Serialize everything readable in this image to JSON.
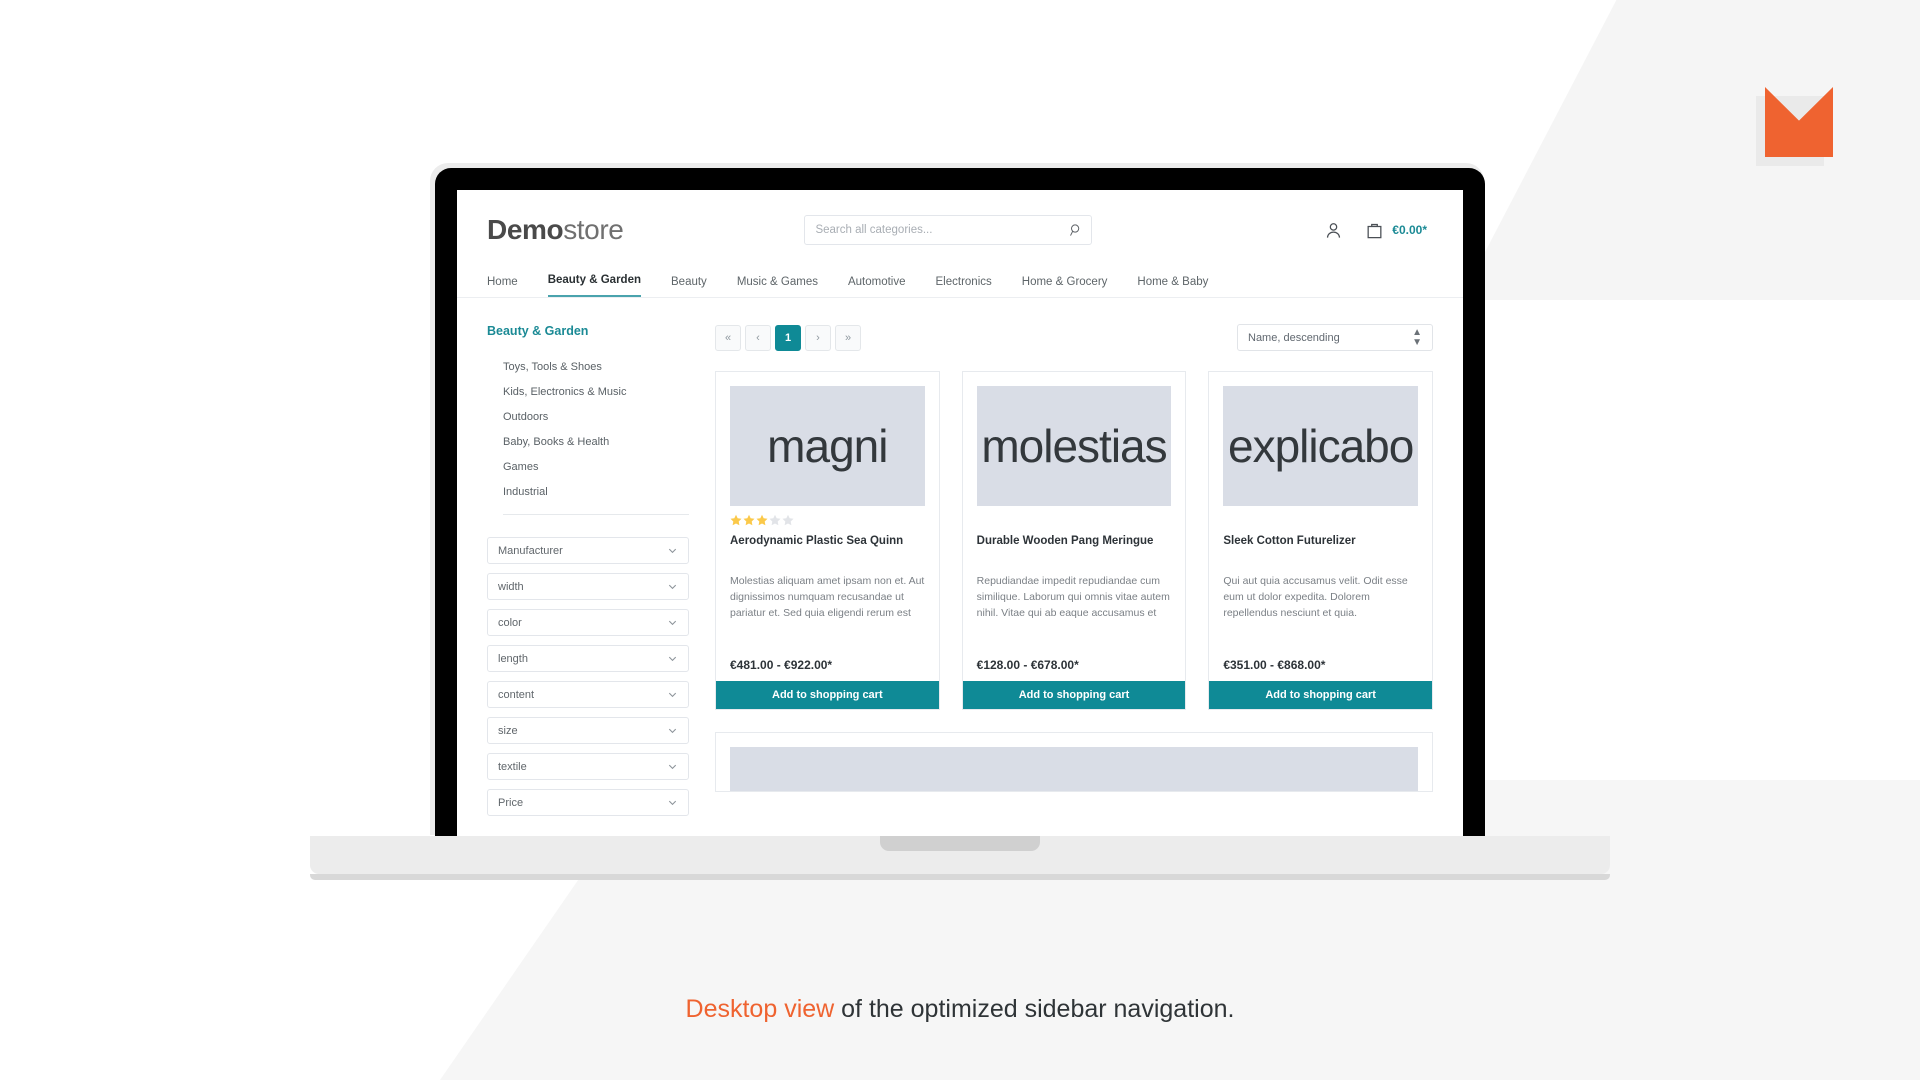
{
  "caption": {
    "highlight": "Desktop view",
    "rest": " of the optimized sidebar navigation."
  },
  "brand": {
    "logo_name": "shopware-m-logo",
    "accent_color": "#ef6330"
  },
  "shop": {
    "logo_bold": "Demo",
    "logo_light": "store",
    "search": {
      "placeholder": "Search all categories...",
      "value": "",
      "icon": "search-icon"
    },
    "account_icon": "user-icon",
    "cart_icon": "bag-icon",
    "cart_amount": "€0.00*",
    "accent_color": "#0f8a96",
    "nav": [
      {
        "label": "Home",
        "active": false
      },
      {
        "label": "Beauty & Garden",
        "active": true
      },
      {
        "label": "Beauty",
        "active": false
      },
      {
        "label": "Music & Games",
        "active": false
      },
      {
        "label": "Automotive",
        "active": false
      },
      {
        "label": "Electronics",
        "active": false
      },
      {
        "label": "Home & Grocery",
        "active": false
      },
      {
        "label": "Home & Baby",
        "active": false
      }
    ]
  },
  "sidebar": {
    "category_title": "Beauty & Garden",
    "categories": [
      {
        "label": "Toys, Tools & Shoes"
      },
      {
        "label": "Kids, Electronics & Music"
      },
      {
        "label": "Outdoors"
      },
      {
        "label": "Baby, Books & Health"
      },
      {
        "label": "Games"
      },
      {
        "label": "Industrial"
      }
    ],
    "filters": [
      {
        "label": "Manufacturer"
      },
      {
        "label": "width"
      },
      {
        "label": "color"
      },
      {
        "label": "length"
      },
      {
        "label": "content"
      },
      {
        "label": "size"
      },
      {
        "label": "textile"
      },
      {
        "label": "Price"
      }
    ]
  },
  "toolbar": {
    "pagination": [
      {
        "label": "«",
        "name": "pagination-first",
        "current": false
      },
      {
        "label": "‹",
        "name": "pagination-prev",
        "current": false
      },
      {
        "label": "1",
        "name": "pagination-page-1",
        "current": true
      },
      {
        "label": "›",
        "name": "pagination-next",
        "current": false
      },
      {
        "label": "»",
        "name": "pagination-last",
        "current": false
      }
    ],
    "sort_value": "Name, descending"
  },
  "products": [
    {
      "image_text": "magni",
      "rating": 3,
      "rating_max": 5,
      "title": "Aerodynamic Plastic Sea Quinn",
      "description": "Molestias aliquam amet ipsam non et. Aut dignissimos numquam recusandae ut pariatur et. Sed quia eligendi rerum est",
      "price": "€481.00 - €922.00*",
      "buy_label": "Add to shopping cart"
    },
    {
      "image_text": "molestias",
      "rating": 0,
      "rating_max": 5,
      "title": "Durable Wooden Pang Meringue",
      "description": "Repudiandae impedit repudiandae cum similique. Laborum qui omnis vitae autem nihil. Vitae qui ab eaque accusamus et",
      "price": "€128.00 - €678.00*",
      "buy_label": "Add to shopping cart"
    },
    {
      "image_text": "explicabo",
      "rating": 0,
      "rating_max": 5,
      "title": "Sleek Cotton Futurelizer",
      "description": "Qui aut quia accusamus velit. Odit esse eum ut dolor expedita. Dolorem repellendus nesciunt et quia.",
      "price": "€351.00 - €868.00*",
      "buy_label": "Add to shopping cart"
    }
  ]
}
